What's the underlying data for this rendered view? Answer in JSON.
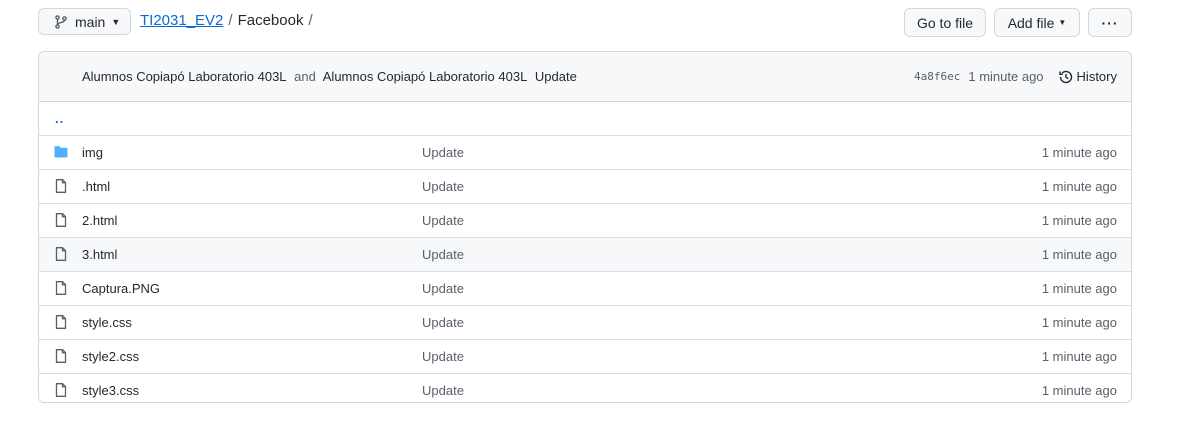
{
  "branch": {
    "label": "main"
  },
  "breadcrumb": {
    "repo": "TI2031_EV2",
    "sep1": "/",
    "folder": "Facebook",
    "sep2": "/"
  },
  "actions": {
    "go_to_file": "Go to file",
    "add_file": "Add file",
    "more": "···"
  },
  "commit": {
    "author1": "Alumnos Copiapó Laboratorio 403L",
    "and": "and",
    "author2": "Alumnos Copiapó Laboratorio 403L",
    "message": "Update",
    "sha": "4a8f6ec",
    "ago": "1 minute ago",
    "history_label": "History"
  },
  "parent_dir": "..",
  "files": [
    {
      "name": "img",
      "type": "folder",
      "icon": "folder-icon",
      "message": "Update",
      "age": "1 minute ago"
    },
    {
      "name": ".html",
      "type": "file",
      "icon": "file-icon",
      "message": "Update",
      "age": "1 minute ago"
    },
    {
      "name": "2.html",
      "type": "file",
      "icon": "file-icon",
      "message": "Update",
      "age": "1 minute ago"
    },
    {
      "name": "3.html",
      "type": "file",
      "icon": "file-icon",
      "message": "Update",
      "age": "1 minute ago"
    },
    {
      "name": "Captura.PNG",
      "type": "file",
      "icon": "file-icon",
      "message": "Update",
      "age": "1 minute ago"
    },
    {
      "name": "style.css",
      "type": "file",
      "icon": "file-icon",
      "message": "Update",
      "age": "1 minute ago"
    },
    {
      "name": "style2.css",
      "type": "file",
      "icon": "file-icon",
      "message": "Update",
      "age": "1 minute ago"
    },
    {
      "name": "style3.css",
      "type": "file",
      "icon": "file-icon",
      "message": "Update",
      "age": "1 minute ago"
    }
  ],
  "colors": {
    "link": "#0969da",
    "folder": "#54aeff",
    "muted": "#57606a",
    "border": "#d0d7de"
  }
}
